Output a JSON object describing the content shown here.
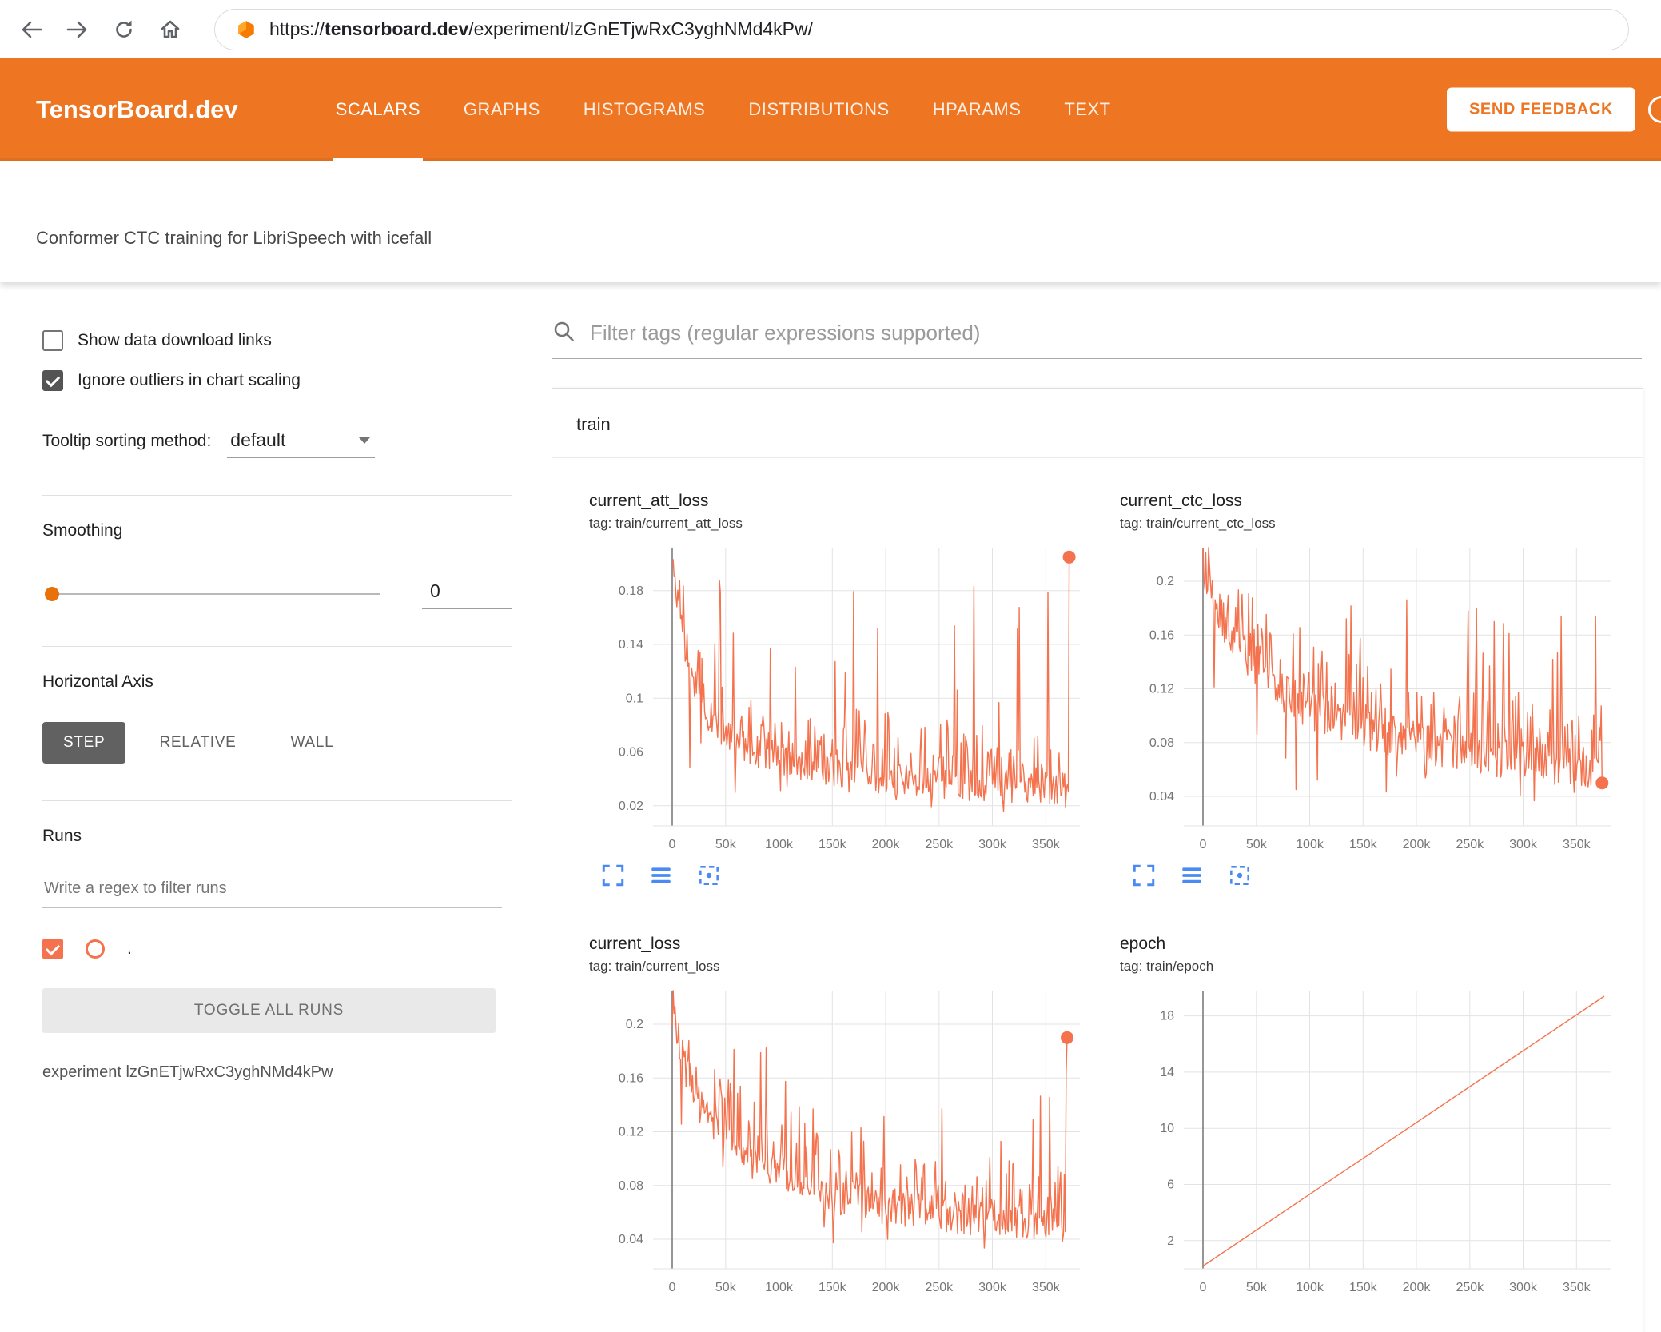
{
  "browser": {
    "url_scheme": "https://",
    "url_host": "tensorboard.dev",
    "url_path": "/experiment/lzGnETjwRxC3yghNMd4kPw/"
  },
  "header": {
    "brand": "TensorBoard.dev",
    "tabs": [
      {
        "label": "SCALARS",
        "active": true
      },
      {
        "label": "GRAPHS",
        "active": false
      },
      {
        "label": "HISTOGRAMS",
        "active": false
      },
      {
        "label": "DISTRIBUTIONS",
        "active": false
      },
      {
        "label": "HPARAMS",
        "active": false
      },
      {
        "label": "TEXT",
        "active": false
      }
    ],
    "feedback_label": "SEND FEEDBACK"
  },
  "experiment": {
    "title": "Conformer CTC training for LibriSpeech with icefall"
  },
  "sidebar": {
    "show_download": {
      "label": "Show data download links",
      "checked": false
    },
    "ignore_outliers": {
      "label": "Ignore outliers in chart scaling",
      "checked": true
    },
    "tooltip_sorting": {
      "label": "Tooltip sorting method:",
      "value": "default"
    },
    "smoothing": {
      "label": "Smoothing",
      "value": "0"
    },
    "horizontal_axis": {
      "label": "Horizontal Axis",
      "options": [
        "STEP",
        "RELATIVE",
        "WALL"
      ],
      "selected": "STEP"
    },
    "runs": {
      "label": "Runs",
      "filter_placeholder": "Write a regex to filter runs",
      "run_name": ".",
      "run_checked": true,
      "toggle_label": "TOGGLE ALL RUNS",
      "experiment_label": "experiment lzGnETjwRxC3yghNMd4kPw"
    }
  },
  "main": {
    "filter_placeholder": "Filter tags (regular expressions supported)",
    "group_title": "train"
  },
  "chart_data": [
    {
      "id": "current_att_loss",
      "type": "line",
      "title": "current_att_loss",
      "tag": "tag: train/current_att_loss",
      "x_range": [
        -18000,
        382000
      ],
      "x_ticks": [
        0,
        50000,
        100000,
        150000,
        200000,
        250000,
        300000,
        350000
      ],
      "x_tick_labels": [
        "0",
        "50k",
        "100k",
        "150k",
        "200k",
        "250k",
        "300k",
        "350k"
      ],
      "ylim": [
        0.005,
        0.212
      ],
      "y_ticks": [
        0.02,
        0.06,
        0.1,
        0.14,
        0.18
      ],
      "y_tick_labels": [
        "0.02",
        "0.06",
        "0.1",
        "0.14",
        "0.18"
      ],
      "grid": true,
      "legend": "none",
      "series": {
        "style": "noisy",
        "seed": 11,
        "n_points": 430,
        "x_start": 0,
        "x_end": 372000,
        "base": [
          [
            0,
            0.195
          ],
          [
            8000,
            0.15
          ],
          [
            16000,
            0.115
          ],
          [
            30000,
            0.085
          ],
          [
            50000,
            0.066
          ],
          [
            80000,
            0.054
          ],
          [
            120000,
            0.045
          ],
          [
            160000,
            0.039
          ],
          [
            200000,
            0.034
          ],
          [
            250000,
            0.03
          ],
          [
            300000,
            0.027
          ],
          [
            372000,
            0.026
          ]
        ],
        "jitter": 0.016,
        "med_prob": 0.3,
        "med_amp": 0.04,
        "spike_prob": 0.09,
        "spike_top": 0.2,
        "dip_prob": 0.05,
        "end_value": 0.205
      },
      "end_marker": true,
      "toolbar": true
    },
    {
      "id": "current_ctc_loss",
      "type": "line",
      "title": "current_ctc_loss",
      "tag": "tag: train/current_ctc_loss",
      "x_range": [
        -18000,
        382000
      ],
      "x_ticks": [
        0,
        50000,
        100000,
        150000,
        200000,
        250000,
        300000,
        350000
      ],
      "x_tick_labels": [
        "0",
        "50k",
        "100k",
        "150k",
        "200k",
        "250k",
        "300k",
        "350k"
      ],
      "ylim": [
        0.018,
        0.225
      ],
      "y_ticks": [
        0.04,
        0.08,
        0.12,
        0.16,
        0.2
      ],
      "y_tick_labels": [
        "0.04",
        "0.08",
        "0.12",
        "0.16",
        "0.2"
      ],
      "grid": true,
      "legend": "none",
      "series": {
        "style": "noisy",
        "seed": 23,
        "n_points": 430,
        "x_start": 0,
        "x_end": 374000,
        "base": [
          [
            0,
            0.205
          ],
          [
            10000,
            0.18
          ],
          [
            20000,
            0.16
          ],
          [
            40000,
            0.135
          ],
          [
            70000,
            0.112
          ],
          [
            100000,
            0.097
          ],
          [
            140000,
            0.085
          ],
          [
            180000,
            0.076
          ],
          [
            220000,
            0.069
          ],
          [
            270000,
            0.062
          ],
          [
            320000,
            0.057
          ],
          [
            374000,
            0.053
          ]
        ],
        "jitter": 0.02,
        "med_prob": 0.35,
        "med_amp": 0.045,
        "spike_prob": 0.07,
        "spike_top": 0.195,
        "dip_prob": 0.05,
        "end_value": 0.05
      },
      "end_marker": true,
      "toolbar": true
    },
    {
      "id": "current_loss",
      "type": "line",
      "title": "current_loss",
      "tag": "tag: train/current_loss",
      "x_range": [
        -18000,
        382000
      ],
      "x_ticks": [
        0,
        50000,
        100000,
        150000,
        200000,
        250000,
        300000,
        350000
      ],
      "x_tick_labels": [
        "0",
        "50k",
        "100k",
        "150k",
        "200k",
        "250k",
        "300k",
        "350k"
      ],
      "ylim": [
        0.018,
        0.225
      ],
      "y_ticks": [
        0.04,
        0.08,
        0.12,
        0.16,
        0.2
      ],
      "y_tick_labels": [
        "0.04",
        "0.08",
        "0.12",
        "0.16",
        "0.2"
      ],
      "grid": true,
      "legend": "none",
      "series": {
        "style": "noisy",
        "seed": 37,
        "n_points": 430,
        "x_start": 0,
        "x_end": 370000,
        "base": [
          [
            0,
            0.205
          ],
          [
            10000,
            0.165
          ],
          [
            20000,
            0.14
          ],
          [
            40000,
            0.115
          ],
          [
            70000,
            0.093
          ],
          [
            100000,
            0.08
          ],
          [
            140000,
            0.068
          ],
          [
            180000,
            0.06
          ],
          [
            220000,
            0.054
          ],
          [
            270000,
            0.049
          ],
          [
            320000,
            0.046
          ],
          [
            370000,
            0.044
          ]
        ],
        "jitter": 0.018,
        "med_prob": 0.32,
        "med_amp": 0.042,
        "spike_prob": 0.08,
        "spike_top": 0.19,
        "dip_prob": 0.05,
        "end_value": 0.19
      },
      "end_marker": true,
      "toolbar": false
    },
    {
      "id": "epoch",
      "type": "line",
      "title": "epoch",
      "tag": "tag: train/epoch",
      "x_range": [
        -18000,
        382000
      ],
      "x_ticks": [
        0,
        50000,
        100000,
        150000,
        200000,
        250000,
        300000,
        350000
      ],
      "x_tick_labels": [
        "0",
        "50k",
        "100k",
        "150k",
        "200k",
        "250k",
        "300k",
        "350k"
      ],
      "ylim": [
        0,
        19.8
      ],
      "y_ticks": [
        2,
        6,
        10,
        14,
        18
      ],
      "y_tick_labels": [
        "2",
        "6",
        "10",
        "14",
        "18"
      ],
      "grid": true,
      "legend": "none",
      "series": {
        "style": "straight",
        "points": [
          [
            0,
            0.2
          ],
          [
            376000,
            19.4
          ]
        ]
      },
      "end_marker": false,
      "toolbar": false
    }
  ],
  "colors": {
    "header_orange": "#ee7622",
    "accent_orange": "#e8710a",
    "line": "#f4734e",
    "toolbar_blue": "#4a8af4",
    "step_gray": "#616161"
  }
}
